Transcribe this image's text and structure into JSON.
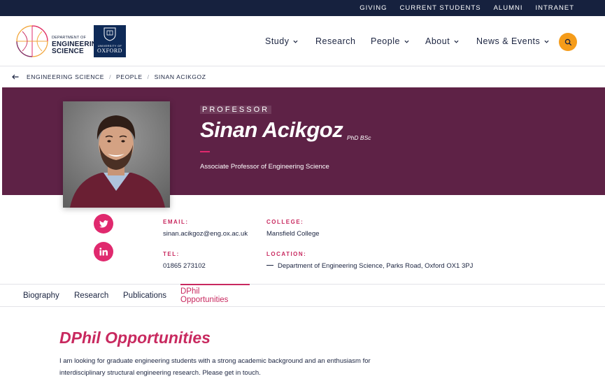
{
  "utility_nav": [
    "GIVING",
    "CURRENT STUDENTS",
    "ALUMNI",
    "INTRANET"
  ],
  "logos": {
    "dept_line1": "DEPARTMENT OF",
    "dept_line2": "ENGINEERING",
    "dept_line3": "SCIENCE",
    "oxford_line1": "UNIVERSITY OF",
    "oxford_line2": "OXFORD"
  },
  "main_nav": {
    "study": "Study",
    "research": "Research",
    "people": "People",
    "about": "About",
    "news": "News & Events"
  },
  "breadcrumb": {
    "crumb1": "ENGINEERING SCIENCE",
    "crumb2": "PEOPLE",
    "crumb3": "SINAN ACIKGOZ",
    "sep": "/"
  },
  "profile": {
    "role": "PROFESSOR",
    "name": "Sinan Acikgoz",
    "qualifications": "PhD BSc",
    "position": "Associate Professor of Engineering Science"
  },
  "contact": {
    "email_label": "EMAIL:",
    "email": "sinan.acikgoz@eng.ox.ac.uk",
    "tel_label": "TEL:",
    "tel": "01865 273102",
    "college_label": "COLLEGE:",
    "college": "Mansfield College",
    "location_label": "LOCATION:",
    "location": "Department of Engineering Science, Parks Road, Oxford OX1 3PJ"
  },
  "tabs": {
    "biography": "Biography",
    "research": "Research",
    "publications": "Publications",
    "dphil": "DPhil Opportunities"
  },
  "content": {
    "title": "DPhil Opportunities",
    "body": "I am looking for graduate engineering students with a strong academic background and an enthusiasm for interdisciplinary structural engineering research. Please get in touch."
  },
  "colors": {
    "navy": "#16213e",
    "hero_plum": "#5e2246",
    "accent_pink": "#c8295f",
    "search_orange": "#f59c1a"
  },
  "icons": {
    "search": "search-icon",
    "twitter": "twitter-icon",
    "linkedin": "linkedin-icon",
    "back": "arrow-left-icon"
  }
}
